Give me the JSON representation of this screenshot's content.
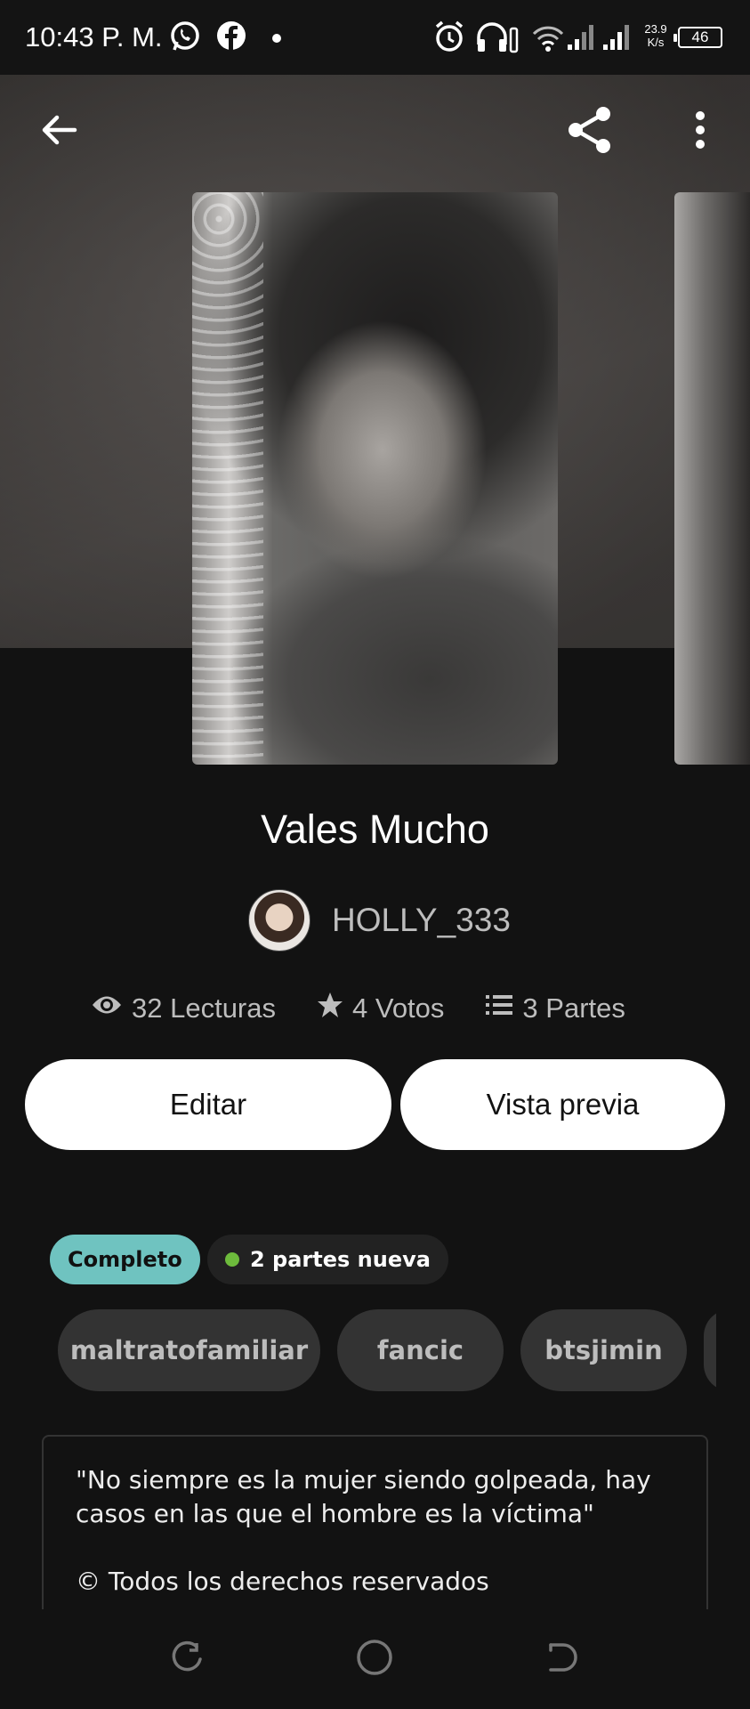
{
  "status_bar": {
    "time": "10:43 P. M.",
    "speed_value": "23.9",
    "speed_unit": "K/s",
    "battery": "46",
    "icons": [
      "whatsapp-icon",
      "facebook-icon",
      "dot-icon",
      "alarm-icon",
      "headphones-icon",
      "wifi-icon",
      "signal-icon",
      "signal-icon"
    ]
  },
  "header": {
    "back_icon": "arrow-left-icon",
    "share_icon": "share-icon",
    "menu_icon": "more-vertical-icon"
  },
  "story": {
    "title": "Vales Mucho",
    "author": "HOLLY_333",
    "stats": {
      "reads": "32 Lecturas",
      "votes": "4 Votos",
      "parts": "3 Partes"
    }
  },
  "actions": {
    "edit": "Editar",
    "preview": "Vista previa"
  },
  "badges": {
    "status": "Completo",
    "new_parts": "2 partes nueva"
  },
  "tags": [
    "maltratofamiliar",
    "fancic",
    "btsjimin"
  ],
  "description": {
    "line1": "\"No siempre es la mujer siendo golpeada, hay casos en las que el hombre es la víctima\"",
    "line2": "© Todos los derechos reservados"
  },
  "colors": {
    "background": "#121212",
    "complete_badge": "#6fc3c0",
    "new_dot": "#6dbb3c",
    "tag_bg": "#333333"
  }
}
